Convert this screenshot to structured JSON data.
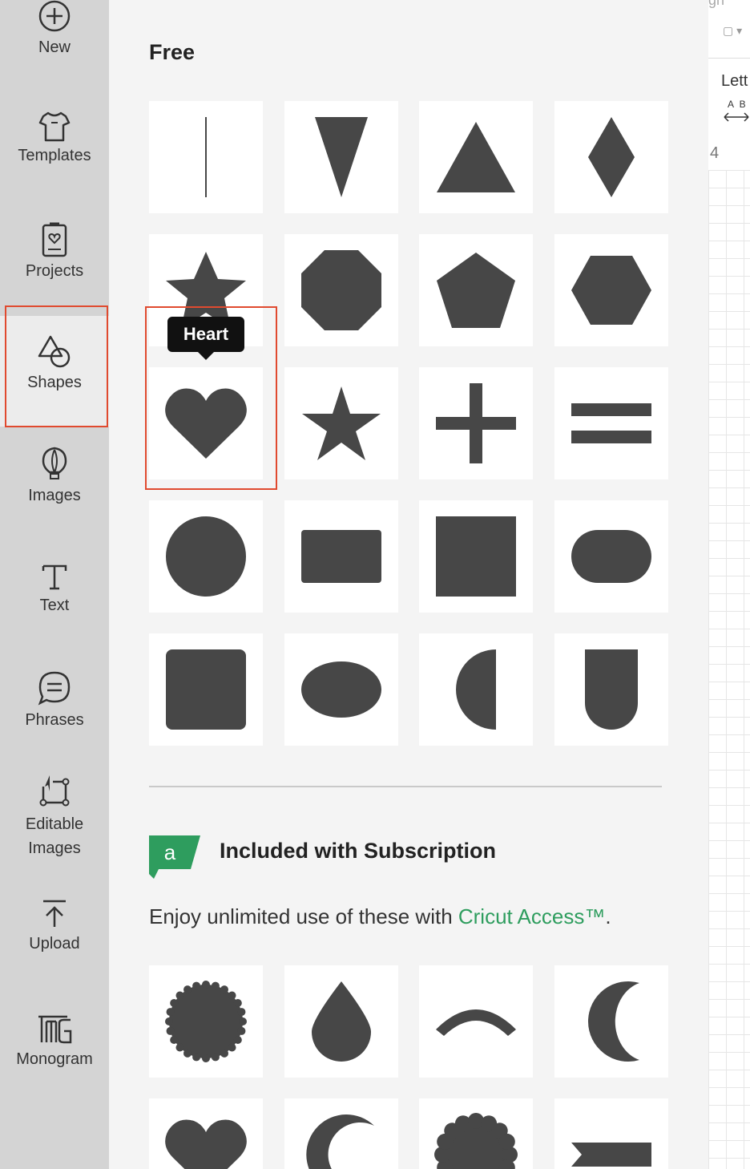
{
  "sidebar": {
    "items": [
      {
        "label": "New",
        "icon": "plus-circle-icon"
      },
      {
        "label": "Templates",
        "icon": "shirt-icon"
      },
      {
        "label": "Projects",
        "icon": "project-clipboard-icon"
      },
      {
        "label": "Shapes",
        "icon": "shapes-icon"
      },
      {
        "label": "Images",
        "icon": "lightbulb-icon"
      },
      {
        "label": "Text",
        "icon": "text-t-icon"
      },
      {
        "label": "Phrases",
        "icon": "speech-bubble-icon"
      },
      {
        "label": "Editable Images",
        "icon": "editable-image-icon"
      },
      {
        "label": "Upload",
        "icon": "upload-icon"
      },
      {
        "label": "Monogram",
        "icon": "monogram-icon"
      }
    ],
    "active": "Shapes"
  },
  "panel": {
    "free_heading": "Free",
    "free_shapes": [
      "line",
      "inverted-triangle",
      "triangle",
      "diamond",
      "star-5-point",
      "octagon",
      "pentagon",
      "hexagon",
      "heart",
      "star",
      "plus",
      "equals",
      "circle",
      "rectangle",
      "square",
      "rounded-pill",
      "rounded-square",
      "ellipse",
      "half-circle",
      "shield-u"
    ],
    "tooltip": "Heart",
    "subscription_heading": "Included with Subscription",
    "subscription_badge": "a",
    "subscription_desc_prefix": "Enjoy unlimited use of these with ",
    "subscription_link": "Cricut Access™",
    "subscription_desc_suffix": ".",
    "subscription_shapes": [
      "starburst-seal",
      "water-drop",
      "arc",
      "crescent-moon",
      "heart",
      "crescent",
      "scalloped-circle",
      "banner-ribbon"
    ]
  },
  "canvas": {
    "letter_label": "Lett",
    "ab_label": "A B",
    "ruler_number": "4",
    "top_label": "gn"
  },
  "colors": {
    "accent_selection": "#e04a2f",
    "shape_fill": "#474747",
    "access_green": "#2e9d5e",
    "sidebar_bg": "#d4d4d4"
  }
}
